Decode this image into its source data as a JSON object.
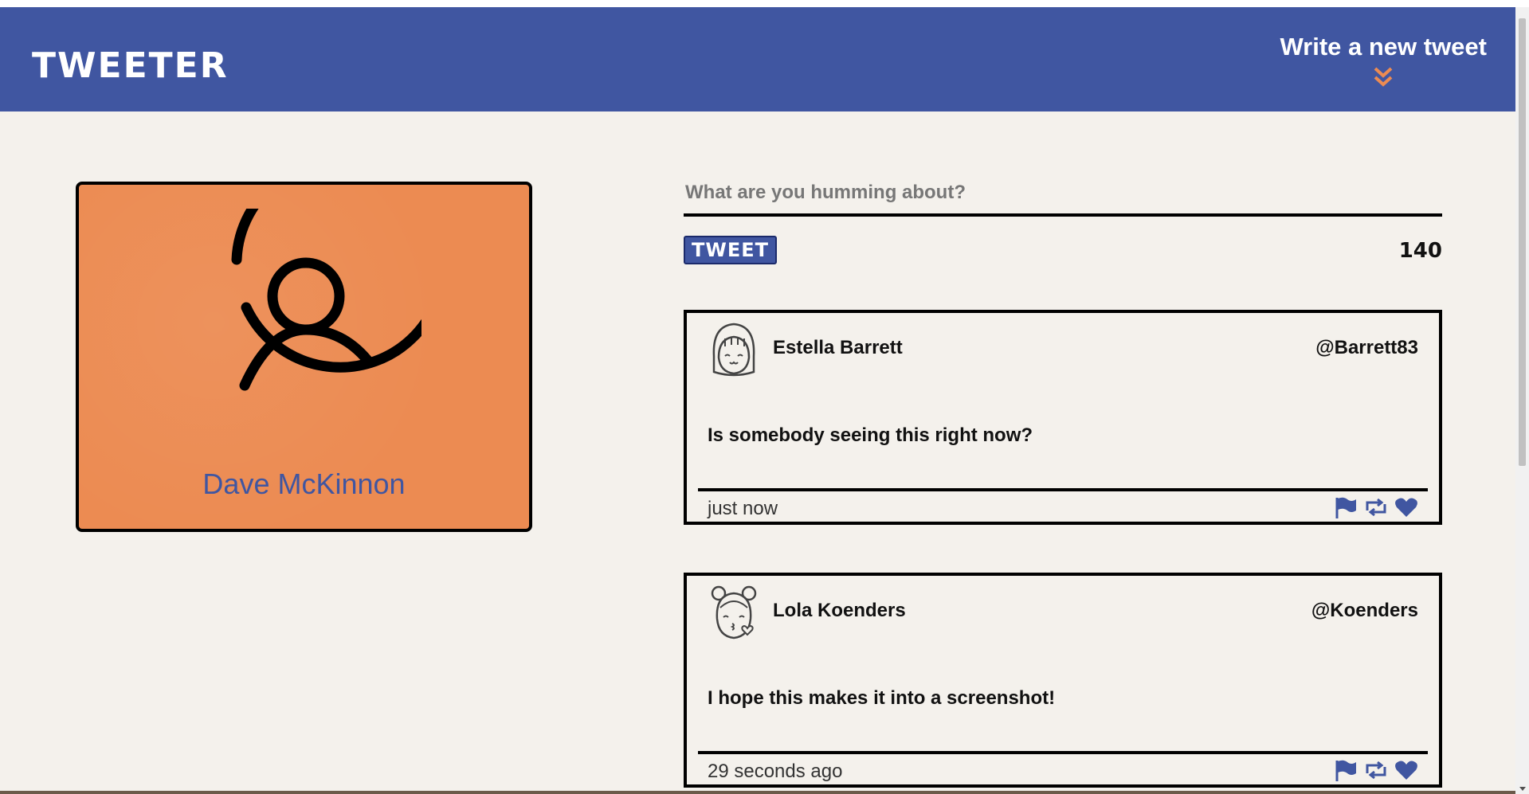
{
  "header": {
    "logo": "TWEETER",
    "compose_link": "Write a new tweet"
  },
  "colors": {
    "header_bg": "#4056a1",
    "accent": "#ec8b52",
    "page_bg": "#f4f1ec"
  },
  "profile": {
    "name": "Dave McKinnon",
    "avatar_icon": "user-circle-icon"
  },
  "composer": {
    "placeholder": "What are you humming about?",
    "button_label": "TWEET",
    "counter": "140"
  },
  "tweets": [
    {
      "name": "Estella Barrett",
      "handle": "@Barrett83",
      "text": "Is somebody seeing this right now?",
      "time": "just now",
      "avatar_icon": "girl-avatar-icon",
      "actions": [
        "flag-icon",
        "retweet-icon",
        "heart-icon"
      ]
    },
    {
      "name": "Lola Koenders",
      "handle": "@Koenders",
      "text": "I hope this makes it into a screenshot!",
      "time": "29 seconds ago",
      "avatar_icon": "girl-kiss-avatar-icon",
      "actions": [
        "flag-icon",
        "retweet-icon",
        "heart-icon"
      ]
    }
  ]
}
